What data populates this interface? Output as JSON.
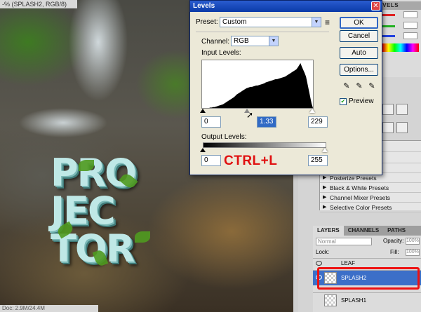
{
  "document": {
    "tab_title": "-% (SPLASH2, RGB/8)",
    "status_text": "Doc: 2.9M/24.4M",
    "art_lines": [
      "PRO",
      "JEC",
      "TOR"
    ]
  },
  "color_panel": {
    "header": "LEVELS",
    "channel_colors": [
      "#e02020",
      "#20b020",
      "#2040e0"
    ]
  },
  "adjustment_presets": {
    "items": [
      "Posterize Presets",
      "Black & White Presets",
      "Channel Mixer Presets",
      "Selective Color Presets"
    ]
  },
  "layers_panel": {
    "tabs": [
      "LAYERS",
      "CHANNELS",
      "PATHS"
    ],
    "blend_mode": "Normal",
    "opacity_label": "Opacity:",
    "opacity_value": "100%",
    "lock_label": "Lock:",
    "fill_label": "Fill:",
    "fill_value": "100%",
    "layers": [
      {
        "name": "LEAF",
        "selected": false
      },
      {
        "name": "SPLASH2",
        "selected": true
      },
      {
        "name": "SPLASH1",
        "selected": false
      }
    ]
  },
  "levels_dialog": {
    "title": "Levels",
    "close_glyph": "✕",
    "preset_label": "Preset:",
    "preset_value": "Custom",
    "preset_menu_glyph": "≡",
    "channel_label": "Channel:",
    "channel_value": "RGB",
    "input_levels_label": "Input Levels:",
    "input_black": "0",
    "input_gamma": "1.33",
    "input_white": "229",
    "output_levels_label": "Output Levels:",
    "output_black": "0",
    "output_white": "255",
    "buttons": {
      "ok": "OK",
      "cancel": "Cancel",
      "auto": "Auto",
      "options": "Options..."
    },
    "preview_label": "Preview",
    "preview_checked": true,
    "annotation": "CTRL+L",
    "histogram": [
      0,
      0,
      0,
      0,
      0,
      0,
      1,
      1,
      2,
      2,
      3,
      4,
      5,
      6,
      7,
      8,
      10,
      12,
      14,
      16,
      18,
      20,
      22,
      24,
      27,
      30,
      32,
      34,
      36,
      38,
      40,
      42,
      44,
      45,
      46,
      47,
      47,
      48,
      49,
      50,
      50,
      51,
      52,
      53,
      54,
      55,
      57,
      58,
      59,
      60,
      61,
      62,
      63,
      64,
      64,
      65,
      66,
      67,
      68,
      69,
      70,
      72,
      74,
      76,
      78,
      80,
      82,
      84,
      86,
      90,
      95,
      100,
      92,
      85,
      78,
      70,
      55,
      40,
      25,
      10
    ]
  }
}
